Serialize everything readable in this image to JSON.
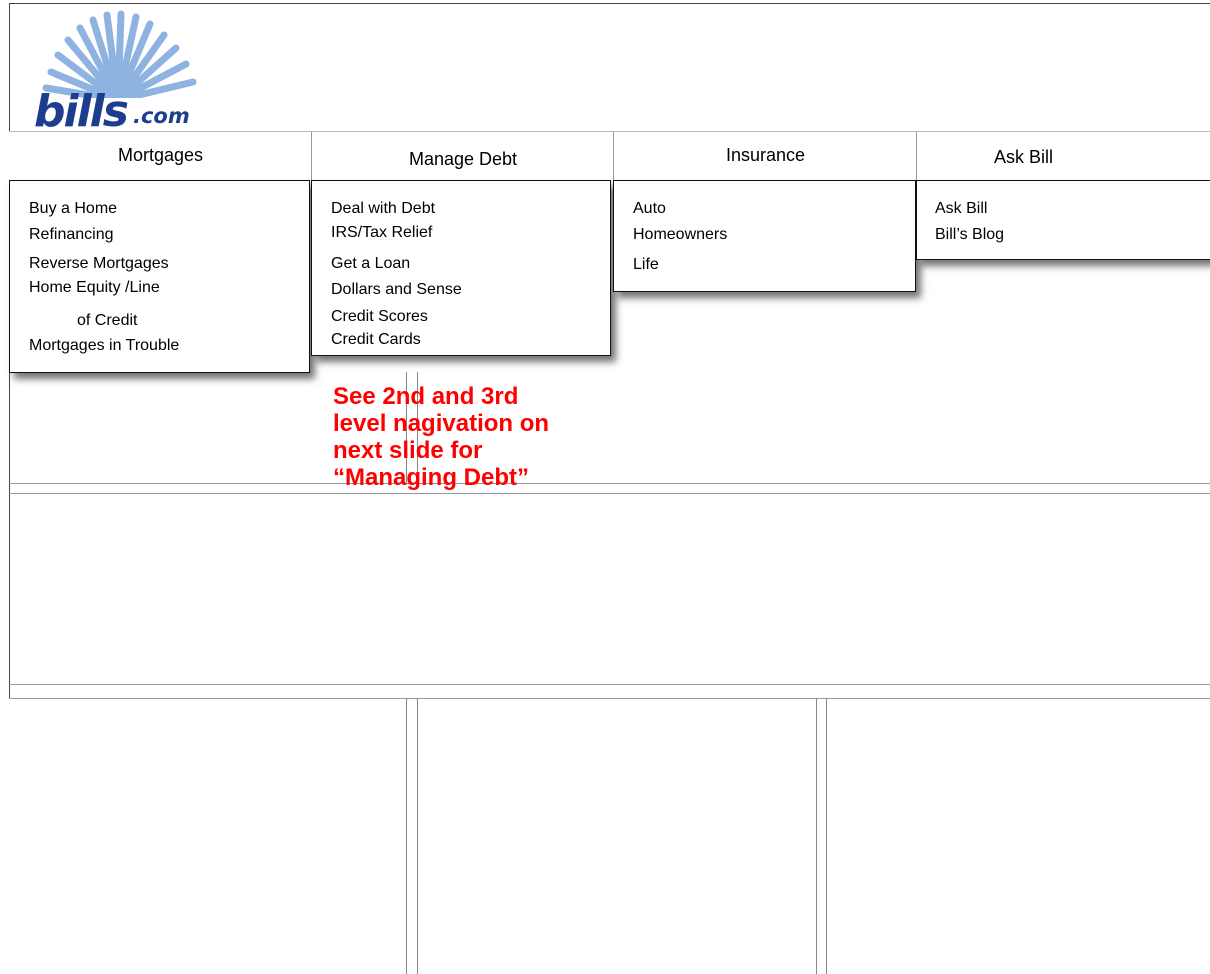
{
  "logo": {
    "brand": "bills",
    "suffix": ".com",
    "icon": "sunburst-logo-icon"
  },
  "nav": {
    "tabs": [
      "Mortgages",
      "Manage Debt",
      "Insurance",
      "Ask Bill"
    ]
  },
  "menus": {
    "mortgages": [
      "Buy a Home",
      "Refinancing",
      "Reverse Mortgages",
      "Home Equity /Line",
      "of Credit",
      "Mortgages in Trouble"
    ],
    "manage_debt": [
      "Deal with Debt",
      "IRS/Tax Relief",
      "Get a Loan",
      "Dollars and Sense",
      "Credit Scores",
      "Credit Cards"
    ],
    "insurance": [
      "Auto",
      "Homeowners",
      "Life"
    ],
    "ask_bill": [
      "Ask Bill",
      "Bill’s Blog"
    ]
  },
  "annotation": {
    "lines": [
      "See 2nd and 3rd",
      "level nagivation on",
      "next slide for",
      "“Managing Debt”"
    ]
  },
  "colors": {
    "brand_blue": "#1d3d8e",
    "sunburst_blue": "#8fb3e0",
    "annotation_red": "#ff0000"
  }
}
